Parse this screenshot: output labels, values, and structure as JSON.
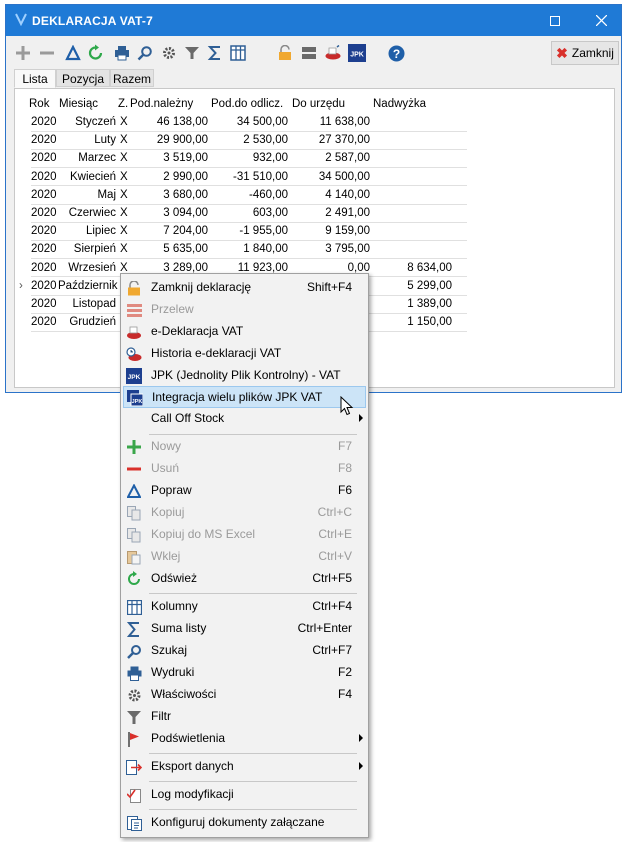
{
  "window": {
    "title": "DEKLARACJA VAT-7",
    "close_label": "Zamknij"
  },
  "tabs": [
    {
      "label": "Lista"
    },
    {
      "label": "Pozycja"
    },
    {
      "label": "Razem"
    }
  ],
  "table": {
    "headers": [
      "Rok",
      "Miesiąc",
      "Z.",
      "Pod.należny",
      "Pod.do odlicz.",
      "Do urzędu",
      "Nadwyżka"
    ],
    "rows": [
      [
        "2020",
        "Styczeń",
        "X",
        "46 138,00",
        "34 500,00",
        "11 638,00",
        ""
      ],
      [
        "2020",
        "Luty",
        "X",
        "29 900,00",
        "2 530,00",
        "27 370,00",
        ""
      ],
      [
        "2020",
        "Marzec",
        "X",
        "3 519,00",
        "932,00",
        "2 587,00",
        ""
      ],
      [
        "2020",
        "Kwiecień",
        "X",
        "2 990,00",
        "-31 510,00",
        "34 500,00",
        ""
      ],
      [
        "2020",
        "Maj",
        "X",
        "3 680,00",
        "-460,00",
        "4 140,00",
        ""
      ],
      [
        "2020",
        "Czerwiec",
        "X",
        "3 094,00",
        "603,00",
        "2 491,00",
        ""
      ],
      [
        "2020",
        "Lipiec",
        "X",
        "7 204,00",
        "-1 955,00",
        "9 159,00",
        ""
      ],
      [
        "2020",
        "Sierpień",
        "X",
        "5 635,00",
        "1 840,00",
        "3 795,00",
        ""
      ],
      [
        "2020",
        "Wrzesień",
        "X",
        "3 289,00",
        "11 923,00",
        "0,00",
        "8 634,00"
      ],
      [
        "2020",
        "Październik",
        "",
        "",
        "",
        "",
        "5 299,00"
      ],
      [
        "2020",
        "Listopad",
        "",
        "",
        "",
        "",
        "1 389,00"
      ],
      [
        "2020",
        "Grudzień",
        "",
        "",
        "",
        "",
        "1 150,00"
      ]
    ]
  },
  "menu": {
    "items": [
      {
        "label": "Zamknij deklarację",
        "shortcut": "Shift+F4"
      },
      {
        "label": "Przelew",
        "shortcut": ""
      },
      {
        "label": "e-Deklaracja VAT",
        "shortcut": ""
      },
      {
        "label": "Historia e-deklaracji VAT",
        "shortcut": ""
      },
      {
        "label": "JPK (Jednolity Plik Kontrolny) - VAT",
        "shortcut": ""
      },
      {
        "label": "Integracja wielu plików JPK VAT",
        "shortcut": ""
      },
      {
        "label": "Call Off Stock",
        "shortcut": ""
      },
      {
        "label": "Nowy",
        "shortcut": "F7"
      },
      {
        "label": "Usuń",
        "shortcut": "F8"
      },
      {
        "label": "Popraw",
        "shortcut": "F6"
      },
      {
        "label": "Kopiuj",
        "shortcut": "Ctrl+C"
      },
      {
        "label": "Kopiuj do MS Excel",
        "shortcut": "Ctrl+E"
      },
      {
        "label": "Wklej",
        "shortcut": "Ctrl+V"
      },
      {
        "label": "Odśwież",
        "shortcut": "Ctrl+F5"
      },
      {
        "label": "Kolumny",
        "shortcut": "Ctrl+F4"
      },
      {
        "label": "Suma listy",
        "shortcut": "Ctrl+Enter"
      },
      {
        "label": "Szukaj",
        "shortcut": "Ctrl+F7"
      },
      {
        "label": "Wydruki",
        "shortcut": "F2"
      },
      {
        "label": "Właściwości",
        "shortcut": "F4"
      },
      {
        "label": "Filtr",
        "shortcut": ""
      },
      {
        "label": "Podświetlenia",
        "shortcut": ""
      },
      {
        "label": "Eksport danych",
        "shortcut": ""
      },
      {
        "label": "Log modyfikacji",
        "shortcut": ""
      },
      {
        "label": "Konfiguruj dokumenty załączane",
        "shortcut": ""
      }
    ]
  },
  "icons": {
    "toolbar": [
      "add-icon",
      "remove-icon",
      "edit-icon",
      "refresh-icon",
      "print-icon",
      "search-icon",
      "settings-icon",
      "filter-icon",
      "sum-icon",
      "columns-icon",
      "lock-icon",
      "transfer-icon",
      "e-declaration-icon",
      "jpk-icon",
      "help-icon"
    ]
  },
  "colors": {
    "titlebar": "#1f7ad6",
    "highlight": "#cce4f7",
    "close_x": "#d9302b"
  }
}
